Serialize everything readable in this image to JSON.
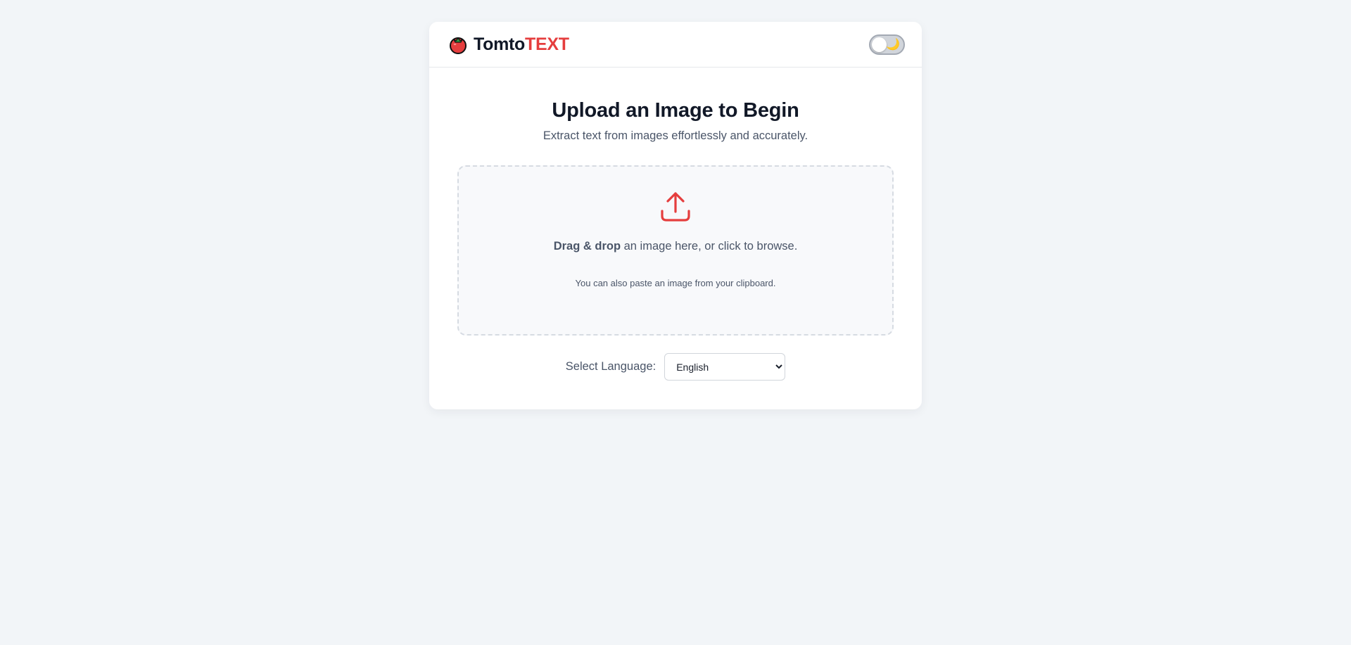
{
  "header": {
    "brand_part1": "Tomto",
    "brand_part2": "TEXT",
    "logo_icon": "tomato-icon",
    "theme_toggle": {
      "state": "off",
      "icon": "moon-icon",
      "glyph": "🌙"
    }
  },
  "main": {
    "title": "Upload an Image to Begin",
    "subtitle": "Extract text from images effortlessly and accurately.",
    "dropzone": {
      "icon": "upload-icon",
      "strong_text": "Drag & drop",
      "rest_text": " an image here, or click to browse.",
      "paste_hint": "You can also paste an image from your clipboard."
    },
    "language": {
      "label": "Select Language:",
      "selected": "English"
    }
  },
  "colors": {
    "accent": "#e53e3e",
    "background": "#f2f5f8",
    "card": "#ffffff",
    "text_primary": "#111827",
    "text_secondary": "#4a5568"
  }
}
